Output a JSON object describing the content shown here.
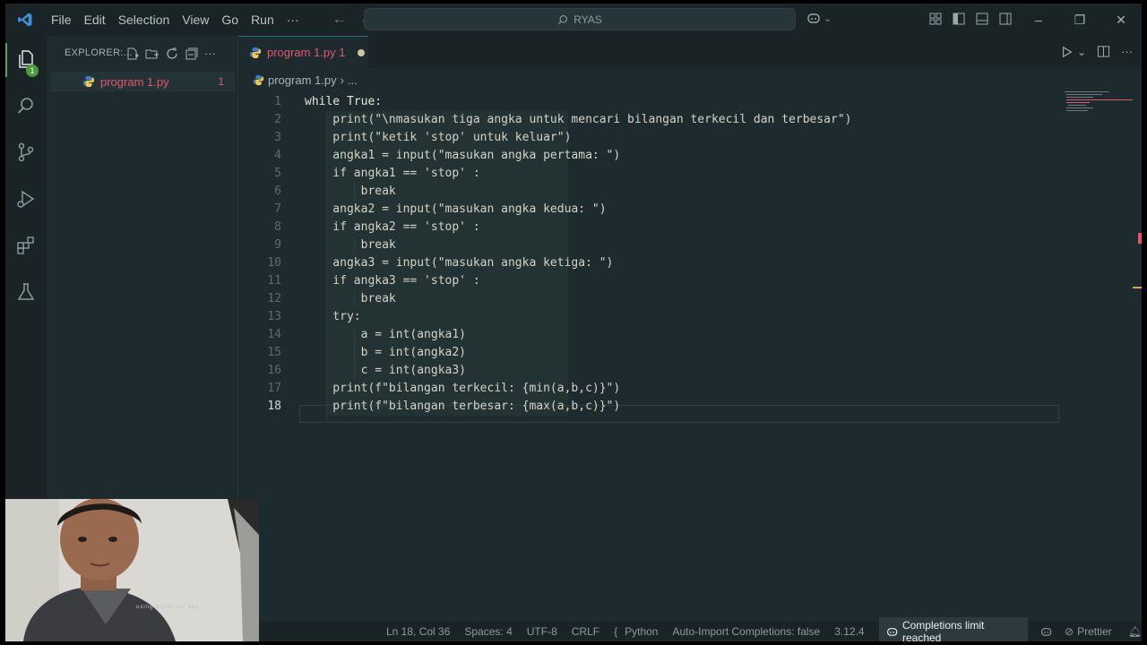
{
  "titlebar": {
    "menu": [
      "File",
      "Edit",
      "Selection",
      "View",
      "Go",
      "Run",
      "···"
    ],
    "search_text": "RYAS"
  },
  "activity": {
    "explorer_badge": "1",
    "icons": [
      "explorer-icon",
      "search-icon",
      "source-control-icon",
      "run-debug-icon",
      "extensions-icon",
      "testing-icon"
    ]
  },
  "sidebar": {
    "header": "EXPLORER:...",
    "file": {
      "name": "program 1.py",
      "count": "1"
    }
  },
  "editor": {
    "tab": {
      "label": "program 1.py 1"
    },
    "breadcrumb": {
      "file": "program 1.py",
      "rest": "..."
    },
    "current_line": "18"
  },
  "code_lines": [
    {
      "n": "1",
      "text": "while True:"
    },
    {
      "n": "2",
      "text": "    print(\"\\nmasukan tiga angka untuk mencari bilangan terkecil dan terbesar\")"
    },
    {
      "n": "3",
      "text": "    print(\"ketik 'stop' untuk keluar\")"
    },
    {
      "n": "4",
      "text": "    angka1 = input(\"masukan angka pertama: \")"
    },
    {
      "n": "5",
      "text": "    if angka1 == 'stop' :"
    },
    {
      "n": "6",
      "text": "        break"
    },
    {
      "n": "7",
      "text": "    angka2 = input(\"masukan angka kedua: \")"
    },
    {
      "n": "8",
      "text": "    if angka2 == 'stop' :"
    },
    {
      "n": "9",
      "text": "        break"
    },
    {
      "n": "10",
      "text": "    angka3 = input(\"masukan angka ketiga: \")"
    },
    {
      "n": "11",
      "text": "    if angka3 == 'stop' :"
    },
    {
      "n": "12",
      "text": "        break"
    },
    {
      "n": "13",
      "text": "    try:"
    },
    {
      "n": "14",
      "text": "        a = int(angka1)"
    },
    {
      "n": "15",
      "text": "        b = int(angka2)"
    },
    {
      "n": "16",
      "text": "        c = int(angka3)"
    },
    {
      "n": "17",
      "text": "    print(f\"bilangan terkecil: {min(a,b,c)}\")"
    },
    {
      "n": "18",
      "text": "    print(f\"bilangan terbesar: {max(a,b,c)}\")"
    }
  ],
  "statusbar": {
    "position": "Ln 18, Col 36",
    "spaces": "Spaces: 4",
    "encoding": "UTF-8",
    "eol": "CRLF",
    "language": "Python",
    "auto_import": "Auto-Import Completions: false",
    "version": "3.12.4",
    "completions": "Completions limit reached",
    "prettier": "Prettier"
  },
  "webcam": {
    "caption": "using droidcam app"
  },
  "colors": {
    "accent_error": "#e0556b",
    "badge": "#4c9a3c",
    "background": "#1e2b2e"
  }
}
